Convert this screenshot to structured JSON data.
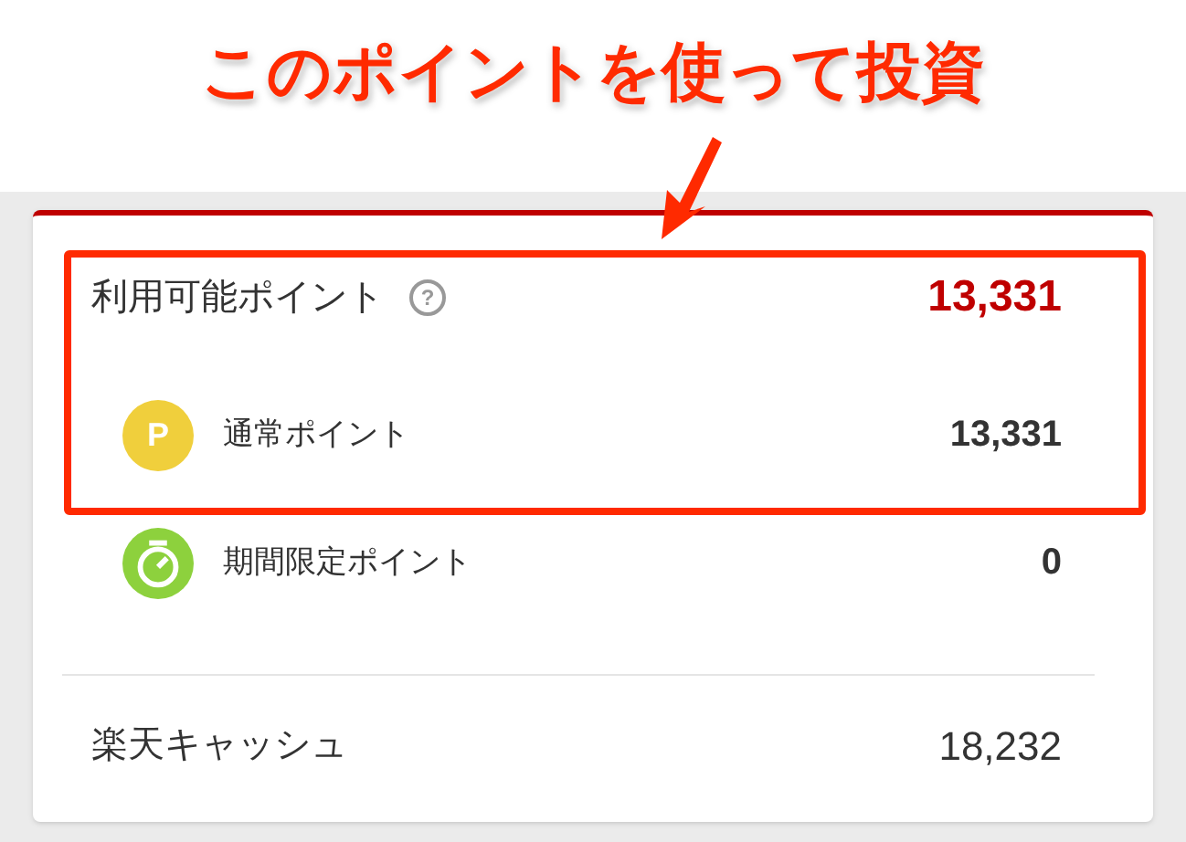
{
  "annotation": {
    "title": "このポイントを使って投資"
  },
  "available_points": {
    "label": "利用可能ポイント",
    "help_icon": "?",
    "value": "13,331"
  },
  "point_types": [
    {
      "kind": "regular",
      "icon_text": "P",
      "label": "通常ポイント",
      "value": "13,331"
    },
    {
      "kind": "limited",
      "label": "期間限定ポイント",
      "value": "0"
    }
  ],
  "rakuten_cash": {
    "label": "楽天キャッシュ",
    "value": "18,232"
  }
}
